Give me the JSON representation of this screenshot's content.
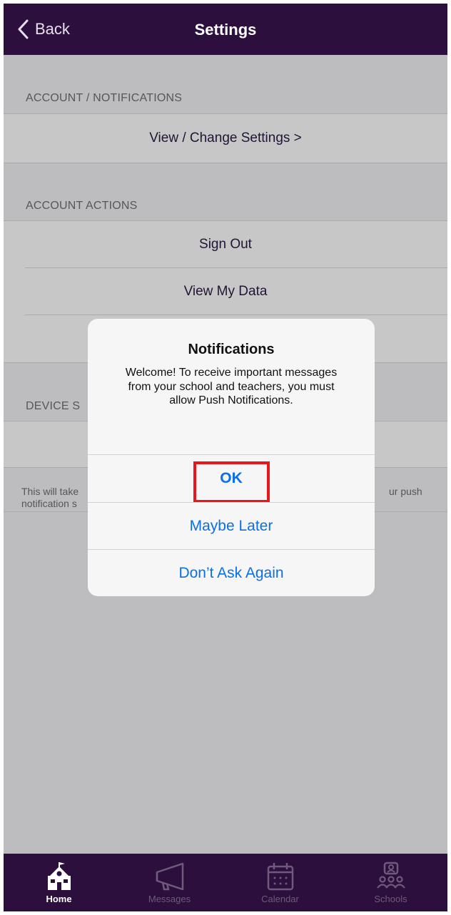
{
  "navbar": {
    "back_label": "Back",
    "title": "Settings"
  },
  "sections": [
    {
      "header": "ACCOUNT / NOTIFICATIONS",
      "rows": [
        "View / Change Settings >"
      ]
    },
    {
      "header": "ACCOUNT ACTIONS",
      "rows": [
        "Sign Out",
        "View My Data"
      ]
    },
    {
      "header": "DEVICE S"
    }
  ],
  "footnote": {
    "left": "This will take",
    "left2": "notification s",
    "right": "ur push"
  },
  "alert": {
    "title": "Notifications",
    "message": "Welcome! To receive important messages from your school and teachers, you must allow Push Notifications.",
    "buttons": {
      "ok": "OK",
      "maybe_later": "Maybe Later",
      "dont_ask": "Don’t Ask Again"
    }
  },
  "tabbar": {
    "home": "Home",
    "messages": "Messages",
    "calendar": "Calendar",
    "schools": "Schools"
  },
  "colors": {
    "brand": "#2c0f3d",
    "link": "#0a6fe8",
    "highlight": "#e8171c"
  }
}
